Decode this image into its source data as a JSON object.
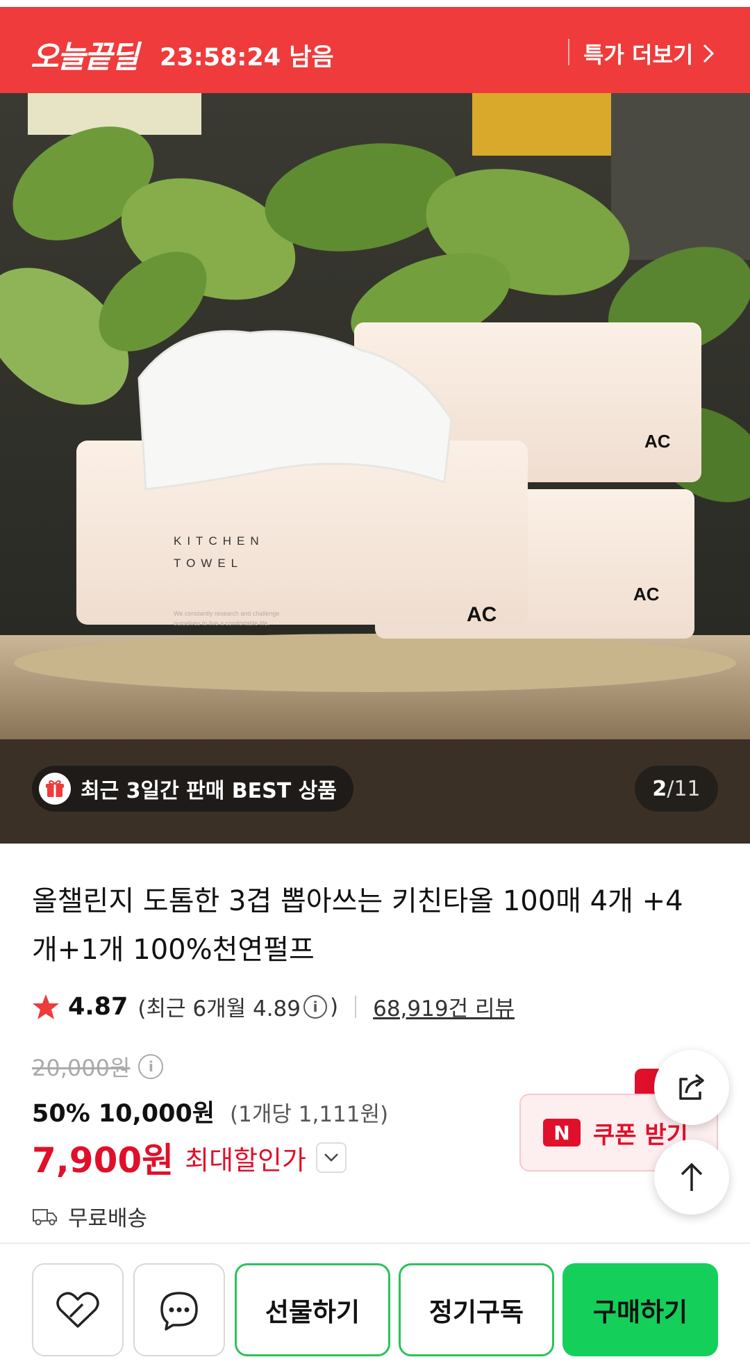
{
  "deal_bar": {
    "logo": "오늘끝딜",
    "timer": "23:58:24 남음",
    "more_label": "특가 더보기"
  },
  "gallery": {
    "best_badge": "최근 3일간 판매 BEST 상품",
    "current_page": "2",
    "separator": "/",
    "total_pages": "11",
    "box_text_line1": "KITCHEN",
    "box_text_line2": "TOWEL",
    "box_slogan_line1": "We constantly research and challenge",
    "box_slogan_line2": "ourselves to live a comfortable life.",
    "box_brand": "AC"
  },
  "product": {
    "title": "올챌린지 도톰한 3겹 뽑아쓰는 키친타올 100매 4개 +4개+1개 100%천연펄프",
    "rating": "4.87",
    "recent_open": "(최근 6개월 4.89",
    "recent_close": ")",
    "review_count": "68,919건 리뷰",
    "original_price": "20,000원",
    "discount_pct": "50%",
    "sale_price": "10,000원",
    "unit_price": "(1개당 1,111원)",
    "max_price": "7,900원",
    "max_label": "최대할인가",
    "shipping": "무료배송"
  },
  "coupon": {
    "n_label": "N",
    "label": "쿠폰 받기"
  },
  "actions": {
    "gift": "선물하기",
    "subscribe": "정기구독",
    "buy": "구매하기"
  },
  "colors": {
    "deal_red": "#ef3b3b",
    "price_red": "#e0102a",
    "buy_green": "#14d05a",
    "outline_green": "#2bc25b"
  },
  "icons": {
    "star": "star-icon",
    "share": "share-icon",
    "scroll_top": "arrow-up-icon",
    "like": "heart-icon",
    "chat": "chat-icon",
    "truck": "truck-icon",
    "gift": "gift-icon"
  }
}
